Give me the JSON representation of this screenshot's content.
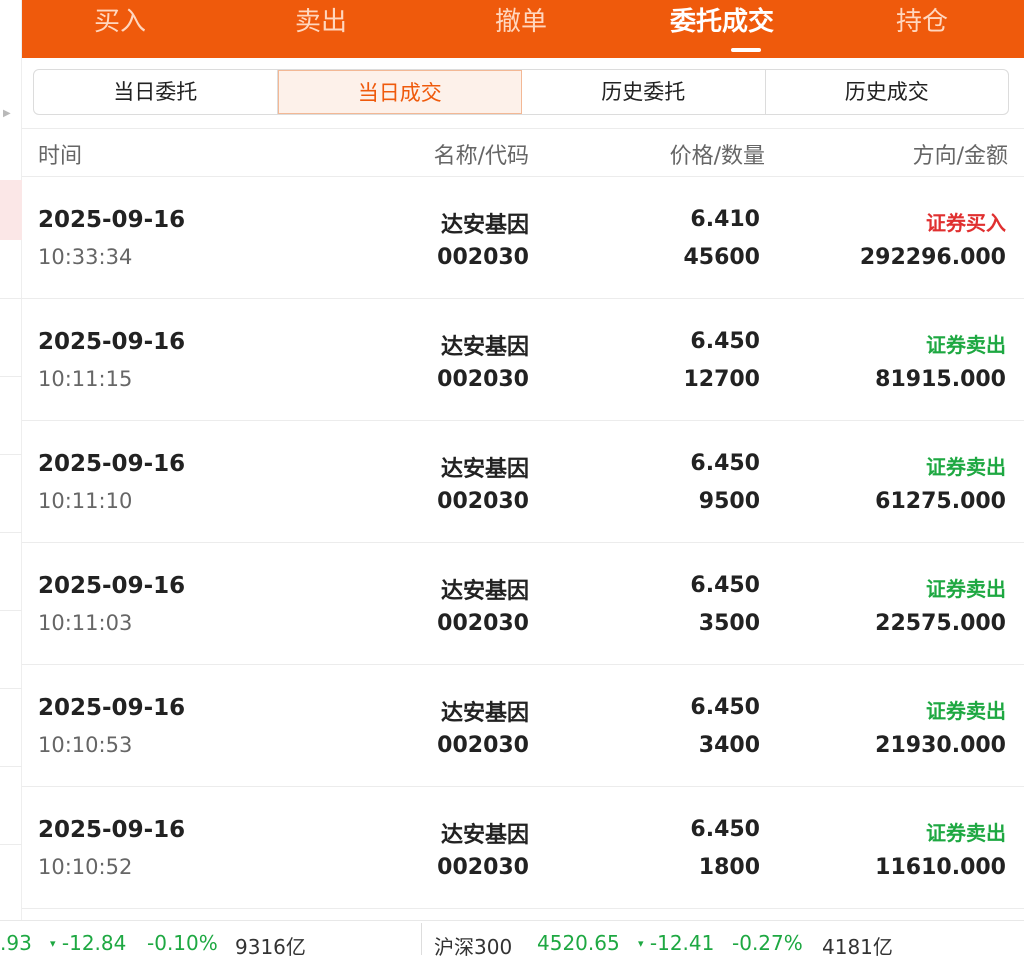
{
  "nav": {
    "tabs": [
      {
        "label": "买入"
      },
      {
        "label": "卖出"
      },
      {
        "label": "撤单"
      },
      {
        "label": "委托成交"
      },
      {
        "label": "持仓"
      }
    ],
    "active_index": 3
  },
  "segments": [
    {
      "label": "当日委托"
    },
    {
      "label": "当日成交"
    },
    {
      "label": "历史委托"
    },
    {
      "label": "历史成交"
    }
  ],
  "columns": {
    "time": "时间",
    "name_code": "名称/代码",
    "price_qty": "价格/数量",
    "dir_amount": "方向/金额"
  },
  "rows": [
    {
      "date": "2025-09-16",
      "time": "10:33:34",
      "name": "达安基因",
      "code": "002030",
      "price": "6.410",
      "qty": "45600",
      "direction": "证券买入",
      "amount": "292296.000"
    },
    {
      "date": "2025-09-16",
      "time": "10:11:15",
      "name": "达安基因",
      "code": "002030",
      "price": "6.450",
      "qty": "12700",
      "direction": "证券卖出",
      "amount": "81915.000"
    },
    {
      "date": "2025-09-16",
      "time": "10:11:10",
      "name": "达安基因",
      "code": "002030",
      "price": "6.450",
      "qty": "9500",
      "direction": "证券卖出",
      "amount": "61275.000"
    },
    {
      "date": "2025-09-16",
      "time": "10:11:03",
      "name": "达安基因",
      "code": "002030",
      "price": "6.450",
      "qty": "3500",
      "direction": "证券卖出",
      "amount": "22575.000"
    },
    {
      "date": "2025-09-16",
      "time": "10:10:53",
      "name": "达安基因",
      "code": "002030",
      "price": "6.450",
      "qty": "3400",
      "direction": "证券卖出",
      "amount": "21930.000"
    },
    {
      "date": "2025-09-16",
      "time": "10:10:52",
      "name": "达安基因",
      "code": "002030",
      "price": "6.450",
      "qty": "1800",
      "direction": "证券卖出",
      "amount": "11610.000"
    }
  ],
  "ticker": {
    "left": {
      "value": ".93",
      "change": "-12.84",
      "pct": "-0.10%",
      "turnover": "9316亿"
    },
    "right": {
      "name": "沪深300",
      "value": "4520.65",
      "change": "-12.41",
      "pct": "-0.27%",
      "turnover": "4181亿"
    },
    "down_glyph": "▾"
  },
  "colors": {
    "brand": "#ef5a0c",
    "buy": "#e03030",
    "sell": "#1ea842",
    "down": "#1ea842"
  }
}
